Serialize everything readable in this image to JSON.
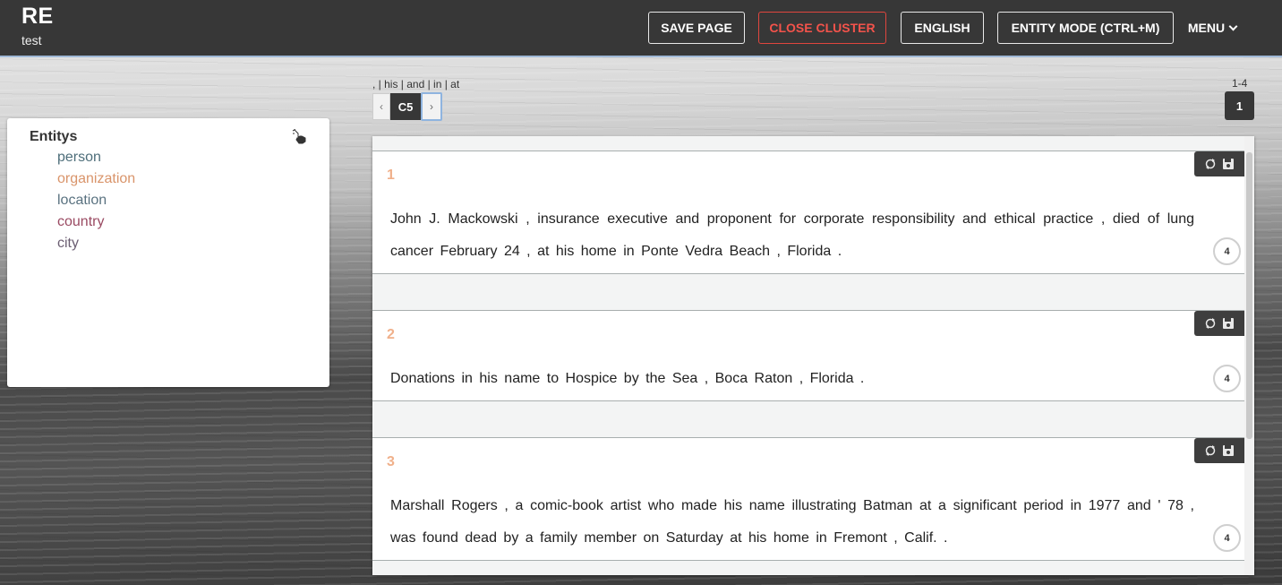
{
  "header": {
    "app_title": "RE",
    "subtitle": "test",
    "buttons": {
      "save": "SAVE PAGE",
      "close_cluster": "CLOSE CLUSTER",
      "language": "ENGLISH",
      "entity_mode": "ENTITY MODE (CTRL+M)",
      "menu": "MENU"
    }
  },
  "sidebar": {
    "title": "Entitys",
    "entities": [
      {
        "label": "person",
        "color": "#4e6e7a"
      },
      {
        "label": "organization",
        "color": "#d9946a"
      },
      {
        "label": "location",
        "color": "#5a7280"
      },
      {
        "label": "country",
        "color": "#9a4a62"
      },
      {
        "label": "city",
        "color": "#6b5e72"
      }
    ]
  },
  "cluster": {
    "keywords": ", | his | and | in | at",
    "prev": "‹",
    "current": "C5",
    "next": "›"
  },
  "pagination": {
    "range": "1-4",
    "page": "1"
  },
  "sentences": [
    {
      "num": "1",
      "text": "John J. Mackowski , insurance executive and proponent for corporate responsibility and ethical practice , died of lung cancer February 24 , at his home in Ponte Vedra Beach , Florida .",
      "count": "4"
    },
    {
      "num": "2",
      "text": "Donations in his name to Hospice by the Sea , Boca Raton , Florida .",
      "count": "4"
    },
    {
      "num": "3",
      "text": "Marshall Rogers , a comic-book artist who made his name illustrating Batman at a significant period in 1977 and ' 78 , was found dead by a family member on Saturday at his home in Fremont , Calif. .",
      "count": "4"
    }
  ]
}
